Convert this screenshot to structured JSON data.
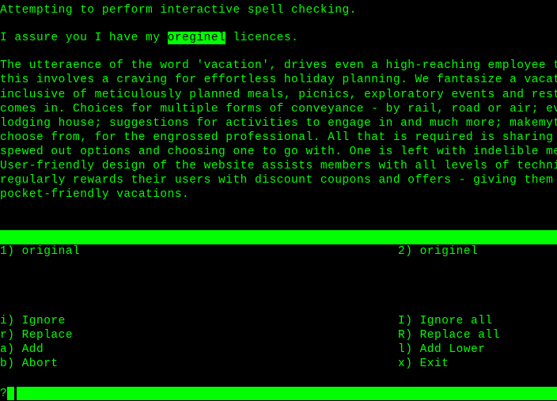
{
  "header_line": "Attempting to perform interactive spell checking.",
  "context_prefix": "I assure you I have my ",
  "highlighted_word": "oreginel",
  "context_suffix": " licences.",
  "paragraph": [
    "The utteraence of the word 'vacation', drives even a high-reaching employee to",
    "this involves a craving for effortless holiday planning. We fantasize a vacatio",
    "inclusive of meticulously planned meals, picnics, exploratory events and rest s",
    "comes in. Choices for multiple forms of conveyance - by rail, road or air; ever",
    "lodging house; suggestions for activities to engage in and much more; makemytri",
    "choose from, for the engrossed professional. All that is required is sharing yo",
    "spewed out options and choosing one to go with. One is left with indelible memo",
    "User-friendly design of the website assists members with all levels of technica",
    "regularly rewards their users with discount coupons and offers - giving them mo",
    "pocket-friendly vacations."
  ],
  "suggestions": {
    "left": "1) original",
    "right": "2) originel"
  },
  "commands": [
    {
      "left": "i) Ignore",
      "right": "I) Ignore all"
    },
    {
      "left": "r) Replace",
      "right": "R) Replace all"
    },
    {
      "left": "a) Add",
      "right": "l) Add Lower"
    },
    {
      "left": "b) Abort",
      "right": "x) Exit"
    }
  ],
  "prompt": "? "
}
